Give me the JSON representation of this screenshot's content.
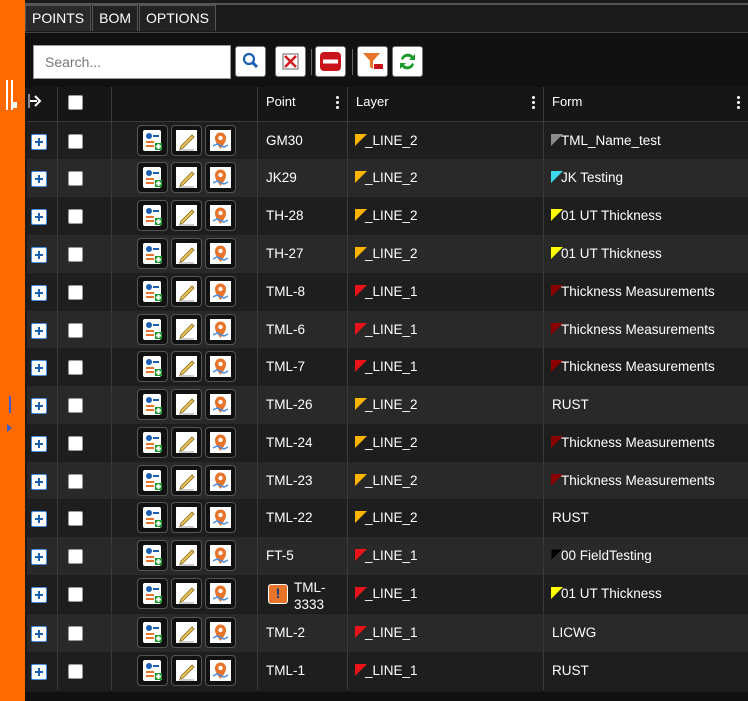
{
  "tabs": [
    "POINTS",
    "BOM",
    "OPTIONS"
  ],
  "toolbar": {
    "search_placeholder": "Search...",
    "buttons": [
      "search-icon",
      "clear-icon",
      "remove-icon",
      "filter-remove-icon",
      "refresh-icon"
    ]
  },
  "columns": {
    "point": "Point",
    "layer": "Layer",
    "form": "Form"
  },
  "colors": {
    "line_1": "#e8141a",
    "line_2": "#ffb400",
    "form_gray": "#8c8c8c",
    "form_cyan": "#3cd9ea",
    "form_yellow": "#ffff00",
    "form_darkred": "#8b0000",
    "form_black": "#000000"
  },
  "rows": [
    {
      "point": "GM30",
      "layer": "_LINE_2",
      "layer_color": "#ffb400",
      "form": "TML_Name_test",
      "form_color": "#8c8c8c",
      "warning": false
    },
    {
      "point": "JK29",
      "layer": "_LINE_2",
      "layer_color": "#ffb400",
      "form": "JK Testing",
      "form_color": "#3cd9ea",
      "warning": false
    },
    {
      "point": "TH-28",
      "layer": "_LINE_2",
      "layer_color": "#ffb400",
      "form": "01 UT Thickness",
      "form_color": "#ffff00",
      "warning": false
    },
    {
      "point": "TH-27",
      "layer": "_LINE_2",
      "layer_color": "#ffb400",
      "form": "01 UT Thickness",
      "form_color": "#ffff00",
      "warning": false
    },
    {
      "point": "TML-8",
      "layer": "_LINE_1",
      "layer_color": "#e8141a",
      "form": "Thickness Measurements",
      "form_color": "#8b0000",
      "warning": false
    },
    {
      "point": "TML-6",
      "layer": "_LINE_1",
      "layer_color": "#e8141a",
      "form": "Thickness Measurements",
      "form_color": "#8b0000",
      "warning": false
    },
    {
      "point": "TML-7",
      "layer": "_LINE_1",
      "layer_color": "#e8141a",
      "form": "Thickness Measurements",
      "form_color": "#8b0000",
      "warning": false
    },
    {
      "point": "TML-26",
      "layer": "_LINE_2",
      "layer_color": "#ffb400",
      "form": "RUST",
      "form_color": "",
      "warning": false
    },
    {
      "point": "TML-24",
      "layer": "_LINE_2",
      "layer_color": "#ffb400",
      "form": "Thickness Measurements",
      "form_color": "#8b0000",
      "warning": false
    },
    {
      "point": "TML-23",
      "layer": "_LINE_2",
      "layer_color": "#ffb400",
      "form": "Thickness Measurements",
      "form_color": "#8b0000",
      "warning": false
    },
    {
      "point": "TML-22",
      "layer": "_LINE_2",
      "layer_color": "#ffb400",
      "form": "RUST",
      "form_color": "",
      "warning": false
    },
    {
      "point": "FT-5",
      "layer": "_LINE_1",
      "layer_color": "#e8141a",
      "form": "00 FieldTesting",
      "form_color": "#000000",
      "warning": false
    },
    {
      "point": "TML-3333",
      "point_line1": "TML-",
      "point_line2": "3333",
      "layer": "_LINE_1",
      "layer_color": "#e8141a",
      "form": "01 UT Thickness",
      "form_color": "#ffff00",
      "warning": true
    },
    {
      "point": "TML-2",
      "layer": "_LINE_1",
      "layer_color": "#e8141a",
      "form": "LICWG",
      "form_color": "",
      "warning": false
    },
    {
      "point": "TML-1",
      "layer": "_LINE_1",
      "layer_color": "#e8141a",
      "form": "RUST",
      "form_color": "",
      "warning": false
    }
  ]
}
